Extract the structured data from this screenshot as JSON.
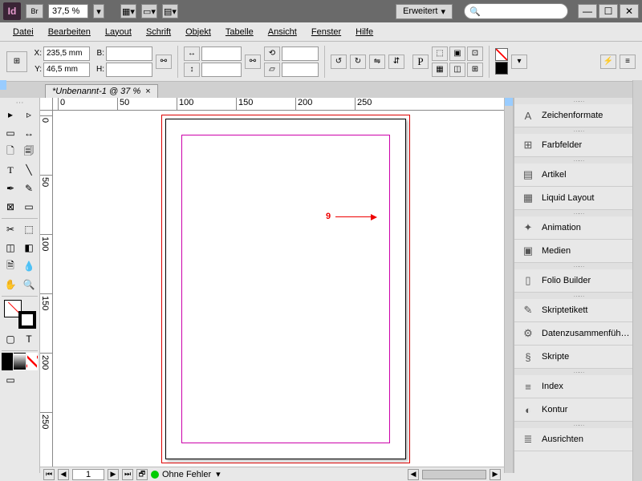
{
  "titlebar": {
    "app_abbr": "Id",
    "bridge": "Br",
    "zoom": "37,5 %",
    "workspace": "Erweitert",
    "search_placeholder": ""
  },
  "menu": {
    "datei": "Datei",
    "bearbeiten": "Bearbeiten",
    "layout": "Layout",
    "schrift": "Schrift",
    "objekt": "Objekt",
    "tabelle": "Tabelle",
    "ansicht": "Ansicht",
    "fenster": "Fenster",
    "hilfe": "Hilfe"
  },
  "control": {
    "x_label": "X:",
    "y_label": "Y:",
    "b_label": "B:",
    "h_label": "H:",
    "x_value": "235,5 mm",
    "y_value": "46,5 mm",
    "b_value": "",
    "h_value": ""
  },
  "doc": {
    "tab_title": "*Unbenannt-1 @ 37 %",
    "close": "×"
  },
  "ruler_h": [
    "0",
    "50",
    "100",
    "150",
    "200",
    "250"
  ],
  "ruler_v": [
    "0",
    "50",
    "100",
    "150",
    "200",
    "250"
  ],
  "annotation": {
    "num": "9"
  },
  "panels": [
    "Zeichenformate",
    "Farbfelder",
    "Artikel",
    "Liquid Layout",
    "Animation",
    "Medien",
    "Folio Builder",
    "Skriptetikett",
    "Datenzusammenfüh…",
    "Skripte",
    "Index",
    "Kontur",
    "Ausrichten"
  ],
  "panel_icons": [
    "A",
    "⊞",
    "▤",
    "▦",
    "✦",
    "▣",
    "▯",
    "✎",
    "⚙",
    "§",
    "≡",
    "◐",
    "≣"
  ],
  "status": {
    "page": "1",
    "preflight": "Ohne Fehler"
  }
}
